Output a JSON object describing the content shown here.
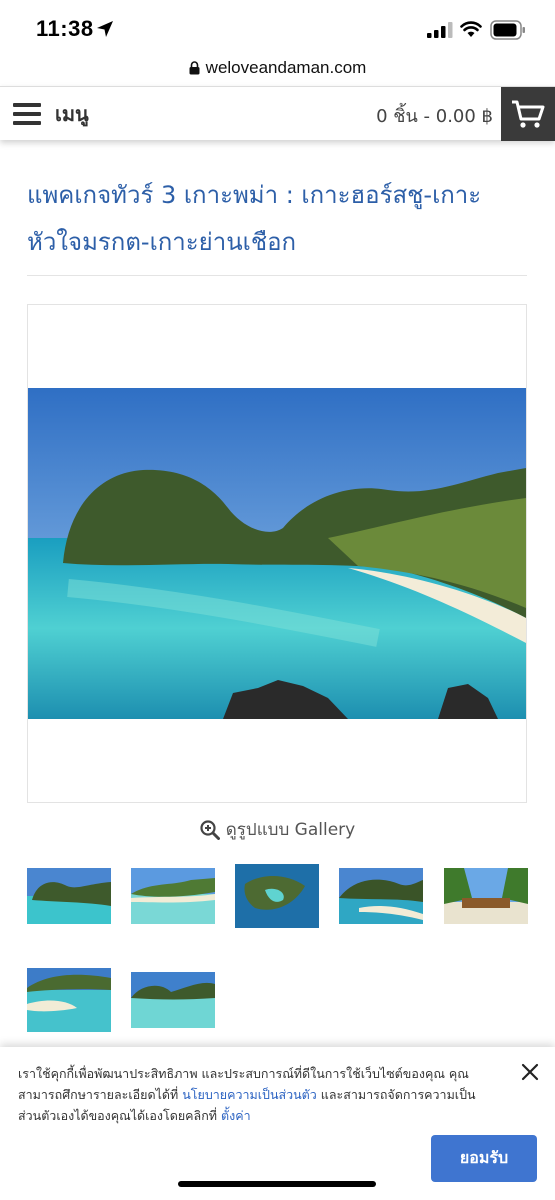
{
  "status_bar": {
    "time": "11:38"
  },
  "browser": {
    "url": "weloveandaman.com"
  },
  "header": {
    "menu_label": "เมนู",
    "cart_summary": "0 ชิ้น - 0.00 ฿"
  },
  "product": {
    "title_line1": "แพคเกจทัวร์ 3 เกาะพม่า : เกาะฮอร์สชู-เกาะ",
    "title_line2": "หัวใจมรกต-เกาะย่านเชือก"
  },
  "gallery": {
    "link_label": "ดูรูปแบบ Gallery",
    "thumbnail_count": 7
  },
  "cookie": {
    "text_part1": "เราใช้คุกกี้เพื่อพัฒนาประสิทธิภาพ และประสบการณ์ที่ดีในการใช้เว็บไซต์ของคุณ คุณสามารถศึกษารายละเอียดได้ที่ ",
    "privacy_link": "นโยบายความเป็นส่วนตัว",
    "text_part2": " และสามารถจัดการความเป็นส่วนตัวเองได้ของคุณได้เองโดยคลิกที่ ",
    "settings_link": "ตั้งค่า",
    "accept_label": "ยอมรับ"
  },
  "icons": {
    "location": "location-arrow-icon",
    "signal": "cellular-signal-icon",
    "wifi": "wifi-icon",
    "battery": "battery-icon",
    "lock": "lock-icon",
    "menu": "hamburger-icon",
    "cart": "cart-icon",
    "zoom": "zoom-in-icon",
    "close": "close-icon"
  },
  "colors": {
    "title": "#2d5fa8",
    "accept_button": "#3f75d0",
    "cart_button": "#3a3a3a",
    "link": "#2c63c2"
  }
}
